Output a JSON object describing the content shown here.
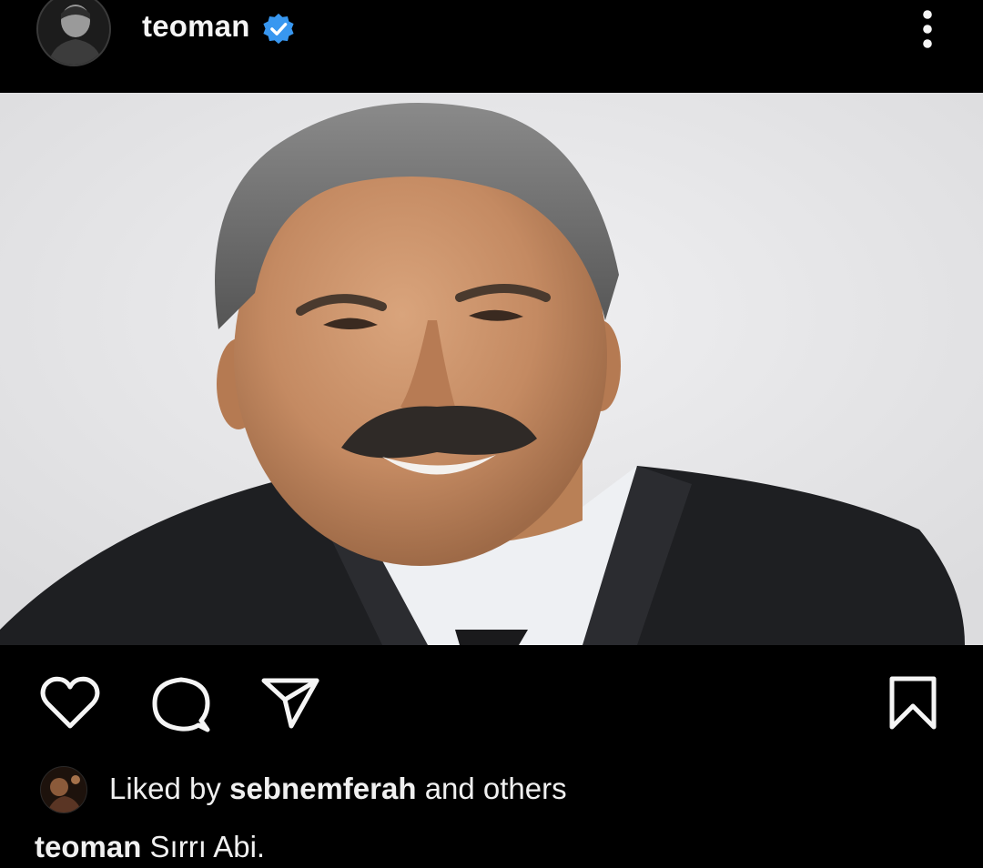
{
  "header": {
    "username": "teoman",
    "verified_color": "#3897f0",
    "avatar_icon": "profile-photo",
    "more_icon": "more-vertical-icon"
  },
  "post_image": {
    "description_icon": "photo"
  },
  "actions": {
    "like_icon": "heart-outline-icon",
    "comment_icon": "comment-bubble-icon",
    "share_icon": "paper-plane-icon",
    "save_icon": "bookmark-outline-icon"
  },
  "likes": {
    "prefix": "Liked by",
    "user": "sebnemferah",
    "suffix": "and others"
  },
  "caption": {
    "username": "teoman",
    "text": "Sırrı Abi."
  }
}
